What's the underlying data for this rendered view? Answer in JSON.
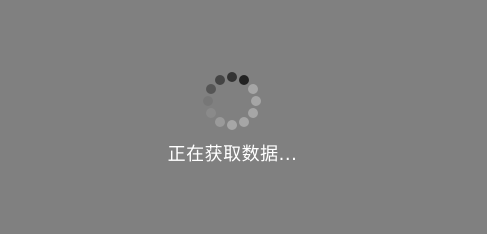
{
  "loading": {
    "message": "正在获取数据...",
    "icon": "spinner-icon",
    "dot_colors": [
      "#222222",
      "#333333",
      "#444444",
      "#555555",
      "#777777",
      "#8a8a8a",
      "#9a9a9a",
      "#a6a6a6",
      "#a6a6a6",
      "#a6a6a6",
      "#a6a6a6",
      "#a6a6a6"
    ]
  },
  "colors": {
    "overlay": "#808080",
    "text": "#ffffff"
  }
}
